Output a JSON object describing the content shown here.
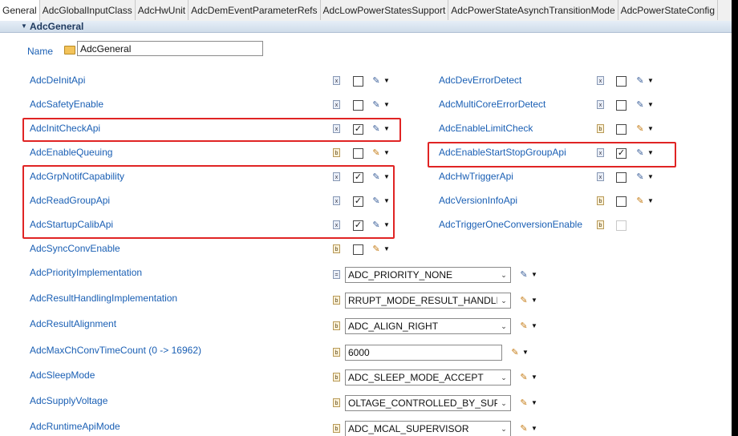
{
  "tabs": [
    "General",
    "AdcGlobalInputClass",
    "AdcHwUnit",
    "AdcDemEventParameterRefs",
    "AdcLowPowerStatesSupport",
    "AdcPowerStateAsynchTransitionMode",
    "AdcPowerStateConfig"
  ],
  "active_tab": "General",
  "section_title": "AdcGeneral",
  "name": {
    "label": "Name",
    "value": "AdcGeneral"
  },
  "left_params": [
    {
      "label": "AdcDeInitApi",
      "checked": false,
      "mode": "calc"
    },
    {
      "label": "AdcSafetyEnable",
      "checked": false,
      "mode": "calc"
    },
    {
      "label": "AdcInitCheckApi",
      "checked": true,
      "mode": "calc"
    },
    {
      "label": "AdcEnableQueuing",
      "checked": false,
      "mode": "pencil"
    },
    {
      "label": "AdcGrpNotifCapability",
      "checked": true,
      "mode": "calc"
    },
    {
      "label": "AdcReadGroupApi",
      "checked": true,
      "mode": "calc"
    },
    {
      "label": "AdcStartupCalibApi",
      "checked": true,
      "mode": "calc"
    },
    {
      "label": "AdcSyncConvEnable",
      "checked": false,
      "mode": "pencil"
    }
  ],
  "right_params": [
    {
      "label": "AdcDevErrorDetect",
      "checked": false,
      "mode": "calc"
    },
    {
      "label": "AdcMultiCoreErrorDetect",
      "checked": false,
      "mode": "calc"
    },
    {
      "label": "AdcEnableLimitCheck",
      "checked": false,
      "mode": "pencil"
    },
    {
      "label": "AdcEnableStartStopGroupApi",
      "checked": true,
      "mode": "calc"
    },
    {
      "label": "AdcHwTriggerApi",
      "checked": false,
      "mode": "calc"
    },
    {
      "label": "AdcVersionInfoApi",
      "checked": false,
      "mode": "pencil"
    },
    {
      "label": "AdcTriggerOneConversionEnable",
      "checked": false,
      "mode": "none"
    }
  ],
  "value_params": [
    {
      "label": "AdcPriorityImplementation",
      "value": "ADC_PRIORITY_NONE",
      "type": "select",
      "mode": "calc"
    },
    {
      "label": "AdcResultHandlingImplementation",
      "value": "RRUPT_MODE_RESULT_HANDLING",
      "type": "select",
      "mode": "pencil"
    },
    {
      "label": "AdcResultAlignment",
      "value": "ADC_ALIGN_RIGHT",
      "type": "select",
      "mode": "pencil"
    },
    {
      "label": "AdcMaxChConvTimeCount (0 -> 16962)",
      "value": "6000",
      "type": "text",
      "mode": "pencil"
    },
    {
      "label": "AdcSleepMode",
      "value": "ADC_SLEEP_MODE_ACCEPT",
      "type": "select",
      "mode": "pencil"
    },
    {
      "label": "AdcSupplyVoltage",
      "value": "OLTAGE_CONTROLLED_BY_SUPPLY",
      "type": "select",
      "mode": "pencil"
    },
    {
      "label": "AdcRuntimeApiMode",
      "value": "ADC_MCAL_SUPERVISOR",
      "type": "select",
      "mode": "pencil"
    }
  ],
  "icons": {
    "checkmark": "✓",
    "calc": "✎",
    "pencil": "✎",
    "arrow": "▼",
    "dropdown": "⌄"
  },
  "colors": {
    "label": "#1a5fb4",
    "highlight": "#e02424",
    "section": "#1f3a5f"
  }
}
